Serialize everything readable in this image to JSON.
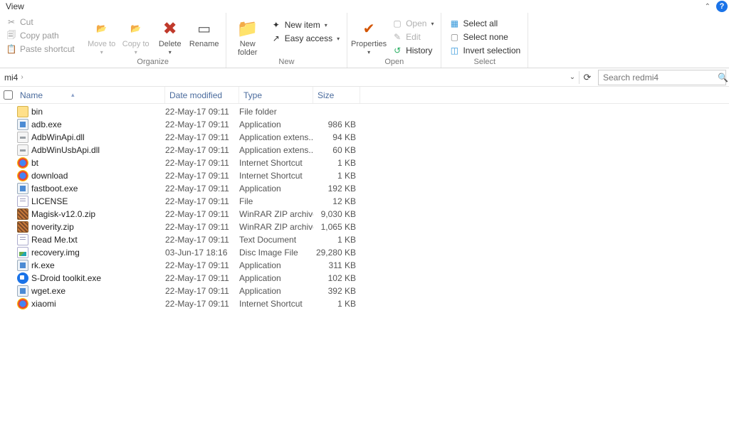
{
  "title": "View",
  "ribbon": {
    "clipboard": {
      "cut": "Cut",
      "copy_path": "Copy path",
      "paste_shortcut": "Paste shortcut"
    },
    "organize": {
      "move_to": "Move to",
      "copy_to": "Copy to",
      "delete": "Delete",
      "rename": "Rename",
      "label": "Organize"
    },
    "new": {
      "new_folder": "New folder",
      "new_item": "New item",
      "easy_access": "Easy access",
      "label": "New"
    },
    "open": {
      "properties": "Properties",
      "open": "Open",
      "edit": "Edit",
      "history": "History",
      "label": "Open"
    },
    "select": {
      "select_all": "Select all",
      "select_none": "Select none",
      "invert": "Invert selection",
      "label": "Select"
    }
  },
  "breadcrumb": {
    "segment": "mi4"
  },
  "search": {
    "placeholder": "Search redmi4"
  },
  "columns": {
    "name": "Name",
    "date": "Date modified",
    "type": "Type",
    "size": "Size"
  },
  "rows": [
    {
      "icon": "folder",
      "name": "bin",
      "date": "22-May-17 09:11",
      "type": "File folder",
      "size": ""
    },
    {
      "icon": "exe",
      "name": "adb.exe",
      "date": "22-May-17 09:11",
      "type": "Application",
      "size": "986 KB"
    },
    {
      "icon": "dll",
      "name": "AdbWinApi.dll",
      "date": "22-May-17 09:11",
      "type": "Application extens...",
      "size": "94 KB"
    },
    {
      "icon": "dll",
      "name": "AdbWinUsbApi.dll",
      "date": "22-May-17 09:11",
      "type": "Application extens...",
      "size": "60 KB"
    },
    {
      "icon": "url",
      "name": "bt",
      "date": "22-May-17 09:11",
      "type": "Internet Shortcut",
      "size": "1 KB"
    },
    {
      "icon": "url",
      "name": "download",
      "date": "22-May-17 09:11",
      "type": "Internet Shortcut",
      "size": "1 KB"
    },
    {
      "icon": "exe",
      "name": "fastboot.exe",
      "date": "22-May-17 09:11",
      "type": "Application",
      "size": "192 KB"
    },
    {
      "icon": "txt",
      "name": "LICENSE",
      "date": "22-May-17 09:11",
      "type": "File",
      "size": "12 KB"
    },
    {
      "icon": "zip",
      "name": "Magisk-v12.0.zip",
      "date": "22-May-17 09:11",
      "type": "WinRAR ZIP archive",
      "size": "9,030 KB"
    },
    {
      "icon": "zip",
      "name": "noverity.zip",
      "date": "22-May-17 09:11",
      "type": "WinRAR ZIP archive",
      "size": "1,065 KB"
    },
    {
      "icon": "txt",
      "name": "Read Me.txt",
      "date": "22-May-17 09:11",
      "type": "Text Document",
      "size": "1 KB"
    },
    {
      "icon": "img",
      "name": "recovery.img",
      "date": "03-Jun-17 18:16",
      "type": "Disc Image File",
      "size": "29,280 KB"
    },
    {
      "icon": "exe",
      "name": "rk.exe",
      "date": "22-May-17 09:11",
      "type": "Application",
      "size": "311 KB"
    },
    {
      "icon": "sd",
      "name": "S-Droid toolkit.exe",
      "date": "22-May-17 09:11",
      "type": "Application",
      "size": "102 KB"
    },
    {
      "icon": "exe",
      "name": "wget.exe",
      "date": "22-May-17 09:11",
      "type": "Application",
      "size": "392 KB"
    },
    {
      "icon": "url",
      "name": "xiaomi",
      "date": "22-May-17 09:11",
      "type": "Internet Shortcut",
      "size": "1 KB"
    }
  ]
}
